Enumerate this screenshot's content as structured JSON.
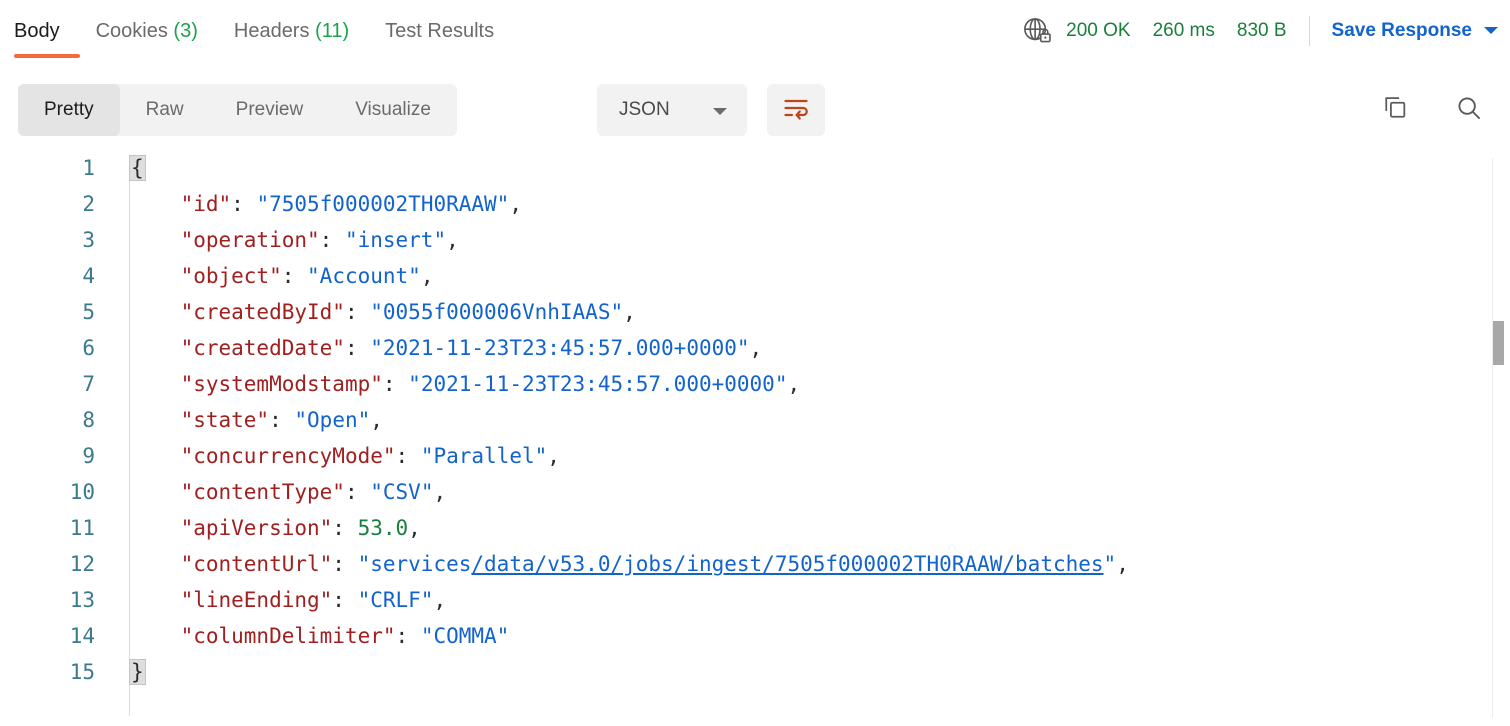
{
  "response_tabs": [
    {
      "label": "Body",
      "count": null,
      "active": true
    },
    {
      "label": "Cookies",
      "count": "(3)",
      "active": false
    },
    {
      "label": "Headers",
      "count": "(11)",
      "active": false
    },
    {
      "label": "Test Results",
      "count": null,
      "active": false
    }
  ],
  "status": {
    "security_icon": "globe-lock-icon",
    "code": "200 OK",
    "time": "260 ms",
    "size": "830 B",
    "save_response_label": "Save Response",
    "save_chevron_icon": "chevron-down-icon",
    "color": "#1a7f3c",
    "link_color": "#1263cc"
  },
  "toolbar": {
    "view_modes": [
      {
        "label": "Pretty",
        "active": true
      },
      {
        "label": "Raw",
        "active": false
      },
      {
        "label": "Preview",
        "active": false
      },
      {
        "label": "Visualize",
        "active": false
      }
    ],
    "format": {
      "value": "JSON",
      "chevron_icon": "chevron-down-icon"
    },
    "wrap_icon": "wrap-text-icon",
    "wrap_icon_color": "#bf4417",
    "copy_icon": "copy-icon",
    "search_icon": "search-icon"
  },
  "accent_color": "#f26b3a",
  "code_view": {
    "language": "JSON",
    "total_lines": 15,
    "lines": [
      {
        "num": "1",
        "tokens": [
          {
            "t": "{",
            "c": "brace"
          }
        ]
      },
      {
        "num": "2",
        "tokens": [
          {
            "t": "    ",
            "c": "p"
          },
          {
            "t": "\"id\"",
            "c": "k"
          },
          {
            "t": ": ",
            "c": "p"
          },
          {
            "t": "\"7505f000002TH0RAAW\"",
            "c": "s"
          },
          {
            "t": ",",
            "c": "p"
          }
        ]
      },
      {
        "num": "3",
        "tokens": [
          {
            "t": "    ",
            "c": "p"
          },
          {
            "t": "\"operation\"",
            "c": "k"
          },
          {
            "t": ": ",
            "c": "p"
          },
          {
            "t": "\"insert\"",
            "c": "s"
          },
          {
            "t": ",",
            "c": "p"
          }
        ]
      },
      {
        "num": "4",
        "tokens": [
          {
            "t": "    ",
            "c": "p"
          },
          {
            "t": "\"object\"",
            "c": "k"
          },
          {
            "t": ": ",
            "c": "p"
          },
          {
            "t": "\"Account\"",
            "c": "s"
          },
          {
            "t": ",",
            "c": "p"
          }
        ]
      },
      {
        "num": "5",
        "tokens": [
          {
            "t": "    ",
            "c": "p"
          },
          {
            "t": "\"createdById\"",
            "c": "k"
          },
          {
            "t": ": ",
            "c": "p"
          },
          {
            "t": "\"0055f000006VnhIAAS\"",
            "c": "s"
          },
          {
            "t": ",",
            "c": "p"
          }
        ]
      },
      {
        "num": "6",
        "tokens": [
          {
            "t": "    ",
            "c": "p"
          },
          {
            "t": "\"createdDate\"",
            "c": "k"
          },
          {
            "t": ": ",
            "c": "p"
          },
          {
            "t": "\"2021-11-23T23:45:57.000+0000\"",
            "c": "s"
          },
          {
            "t": ",",
            "c": "p"
          }
        ]
      },
      {
        "num": "7",
        "tokens": [
          {
            "t": "    ",
            "c": "p"
          },
          {
            "t": "\"systemModstamp\"",
            "c": "k"
          },
          {
            "t": ": ",
            "c": "p"
          },
          {
            "t": "\"2021-11-23T23:45:57.000+0000\"",
            "c": "s"
          },
          {
            "t": ",",
            "c": "p"
          }
        ]
      },
      {
        "num": "8",
        "tokens": [
          {
            "t": "    ",
            "c": "p"
          },
          {
            "t": "\"state\"",
            "c": "k"
          },
          {
            "t": ": ",
            "c": "p"
          },
          {
            "t": "\"Open\"",
            "c": "s"
          },
          {
            "t": ",",
            "c": "p"
          }
        ]
      },
      {
        "num": "9",
        "tokens": [
          {
            "t": "    ",
            "c": "p"
          },
          {
            "t": "\"concurrencyMode\"",
            "c": "k"
          },
          {
            "t": ": ",
            "c": "p"
          },
          {
            "t": "\"Parallel\"",
            "c": "s"
          },
          {
            "t": ",",
            "c": "p"
          }
        ]
      },
      {
        "num": "10",
        "tokens": [
          {
            "t": "    ",
            "c": "p"
          },
          {
            "t": "\"contentType\"",
            "c": "k"
          },
          {
            "t": ": ",
            "c": "p"
          },
          {
            "t": "\"CSV\"",
            "c": "s"
          },
          {
            "t": ",",
            "c": "p"
          }
        ]
      },
      {
        "num": "11",
        "tokens": [
          {
            "t": "    ",
            "c": "p"
          },
          {
            "t": "\"apiVersion\"",
            "c": "k"
          },
          {
            "t": ": ",
            "c": "p"
          },
          {
            "t": "53.0",
            "c": "n"
          },
          {
            "t": ",",
            "c": "p"
          }
        ]
      },
      {
        "num": "12",
        "tokens": [
          {
            "t": "    ",
            "c": "p"
          },
          {
            "t": "\"contentUrl\"",
            "c": "k"
          },
          {
            "t": ": ",
            "c": "p"
          },
          {
            "t": "\"services",
            "c": "s"
          },
          {
            "t": "/data/v53.0/jobs/ingest/7505f000002TH0RAAW/batches",
            "c": "link"
          },
          {
            "t": "\"",
            "c": "s"
          },
          {
            "t": ",",
            "c": "p"
          }
        ]
      },
      {
        "num": "13",
        "tokens": [
          {
            "t": "    ",
            "c": "p"
          },
          {
            "t": "\"lineEnding\"",
            "c": "k"
          },
          {
            "t": ": ",
            "c": "p"
          },
          {
            "t": "\"CRLF\"",
            "c": "s"
          },
          {
            "t": ",",
            "c": "p"
          }
        ]
      },
      {
        "num": "14",
        "tokens": [
          {
            "t": "    ",
            "c": "p"
          },
          {
            "t": "\"columnDelimiter\"",
            "c": "k"
          },
          {
            "t": ": ",
            "c": "p"
          },
          {
            "t": "\"COMMA\"",
            "c": "s"
          }
        ]
      },
      {
        "num": "15",
        "tokens": [
          {
            "t": "}",
            "c": "brace"
          }
        ]
      }
    ]
  }
}
